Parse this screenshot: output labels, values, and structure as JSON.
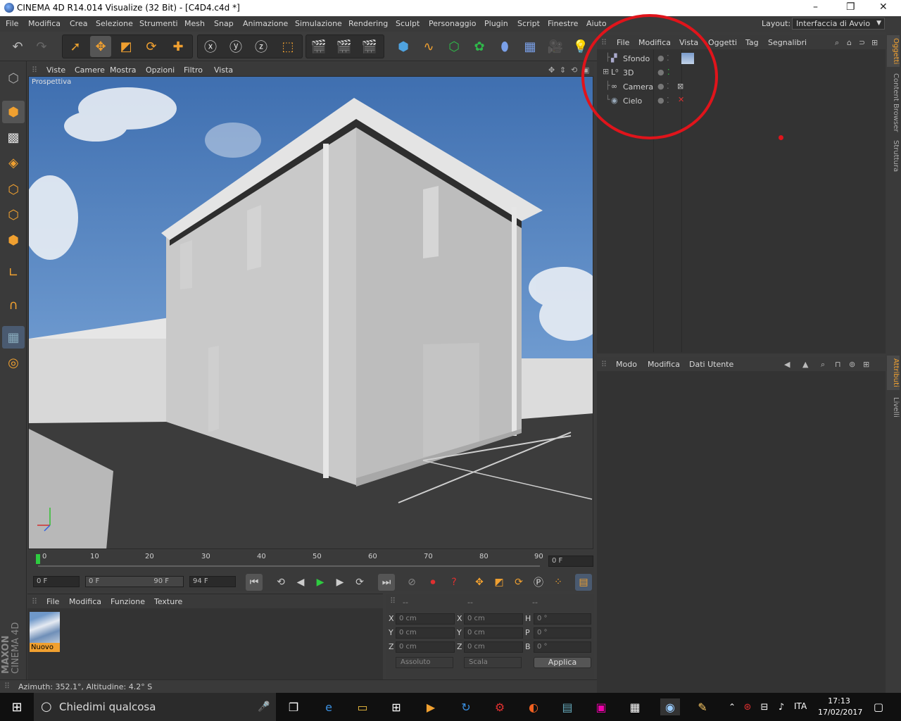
{
  "window": {
    "title": "CINEMA 4D R14.014 Visualize (32 Bit) - [C4D4.c4d *]",
    "controls": [
      "–",
      "❐",
      "✕"
    ]
  },
  "menubar": {
    "items": [
      "File",
      "Modifica",
      "Crea",
      "Selezione",
      "Strumenti",
      "Mesh",
      "Snap",
      "Animazione",
      "Simulazione",
      "Rendering",
      "Sculpt",
      "Personaggio",
      "Plugin",
      "Script",
      "Finestre",
      "Aiuto"
    ],
    "layout_label": "Layout:",
    "layout_value": "Interfaccia di Avvio"
  },
  "viewport": {
    "menu": [
      "Viste",
      "Camere",
      "Mostra",
      "Opzioni",
      "Filtro",
      "Vista"
    ],
    "label": "Prospettiva"
  },
  "timeline": {
    "ticks": [
      "0",
      "10",
      "20",
      "30",
      "40",
      "50",
      "60",
      "70",
      "80",
      "90"
    ],
    "current_frame": "0 F",
    "start_field": "0 F",
    "range_start": "0 F",
    "range_end": "90 F",
    "end_field": "94 F"
  },
  "material_manager": {
    "menu": [
      "File",
      "Modifica",
      "Funzione",
      "Texture"
    ],
    "materials": [
      {
        "name": "Nuovo"
      }
    ]
  },
  "coordinates": {
    "headers": [
      "--",
      "--",
      "--"
    ],
    "rows": [
      {
        "l1": "X",
        "v1": "0 cm",
        "l2": "X",
        "v2": "0 cm",
        "l3": "H",
        "v3": "0 °"
      },
      {
        "l1": "Y",
        "v1": "0 cm",
        "l2": "Y",
        "v2": "0 cm",
        "l3": "P",
        "v3": "0 °"
      },
      {
        "l1": "Z",
        "v1": "0 cm",
        "l2": "Z",
        "v2": "0 cm",
        "l3": "B",
        "v3": "0 °"
      }
    ],
    "mode_select": "Assoluto",
    "scale_select": "Scala",
    "apply_label": "Applica"
  },
  "status": {
    "text": "Azimuth: 352.1°, Altitudine: 4.2°  S"
  },
  "brand": {
    "line1": "MAXON",
    "line2": "CINEMA 4D"
  },
  "object_manager": {
    "menu": [
      "File",
      "Modifica",
      "Vista",
      "Oggetti",
      "Tag",
      "Segnalibri"
    ],
    "objects": [
      {
        "name": "Sfondo",
        "icon": "background-icon"
      },
      {
        "name": "3D",
        "icon": "null-icon"
      },
      {
        "name": "Camera",
        "icon": "camera-icon"
      },
      {
        "name": "Cielo",
        "icon": "sky-icon"
      }
    ]
  },
  "attribute_manager": {
    "menu": [
      "Modo",
      "Modifica",
      "Dati Utente"
    ]
  },
  "right_tabs": [
    "Oggetti",
    "Content Browser",
    "Struttura",
    "Attributi",
    "Livelli"
  ],
  "taskbar": {
    "search_placeholder": "Chiedimi qualcosa",
    "language": "ITA",
    "time": "17:13",
    "date": "17/02/2017"
  },
  "colors": {
    "accent_orange": "#f0a030",
    "annotation_red": "#e0141b",
    "play_green": "#2ecc40"
  }
}
